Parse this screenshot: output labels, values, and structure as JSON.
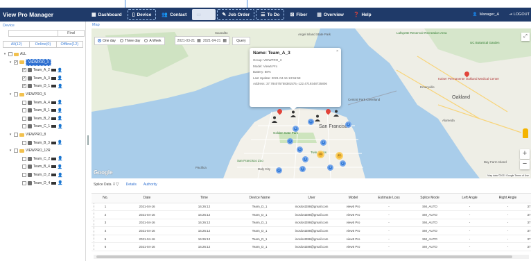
{
  "nav": {
    "brand": "View Pro Manager",
    "items": [
      {
        "label": "Dashboard",
        "icon": "grid-icon"
      },
      {
        "label": "Device",
        "icon": "phone-icon"
      },
      {
        "label": "Contact",
        "icon": "people-icon"
      },
      {
        "label": "",
        "icon": "monitor-icon"
      },
      {
        "label": "Job Order",
        "icon": "wrench-icon"
      },
      {
        "label": "To Do",
        "icon": "list-icon"
      },
      {
        "label": "Fiber",
        "icon": "fiber-icon"
      },
      {
        "label": "Overview",
        "icon": "chart-icon"
      },
      {
        "label": "Help",
        "icon": "help-icon"
      }
    ],
    "user": "Manager_A",
    "logout": "LOGOUT"
  },
  "side_fragments": [
    "ão",
    "s"
  ],
  "left_panel": {
    "title": "Device",
    "search_placeholder": "",
    "find_label": "Find",
    "filter_tabs": [
      "All(12)",
      "Online(0)",
      "Offline(12)"
    ],
    "tree": {
      "root": "ALL",
      "groups": [
        {
          "name": "VIEWPRO_3",
          "selected": true,
          "checked": true,
          "devices": [
            "Team_A_2",
            "Team_A_3",
            "Team_D_1"
          ]
        },
        {
          "name": "VIEWPRO_5",
          "selected": false,
          "checked": false,
          "devices": [
            "Team_A_4",
            "Team_B_1",
            "Team_B_2",
            "Team_C_1"
          ]
        },
        {
          "name": "VIEWPRO_8",
          "selected": false,
          "checked": false,
          "devices": [
            "Team_B_3"
          ]
        },
        {
          "name": "VIEWPRO_12R",
          "selected": false,
          "checked": false,
          "devices": [
            "Team_C_2",
            "Team_B_4",
            "Team_D_2",
            "Team_D_4"
          ]
        }
      ]
    }
  },
  "map": {
    "label": "Map",
    "ranges": [
      "One day",
      "Three day",
      "A Week"
    ],
    "selected_range": "One day",
    "date_from": "2021-03-21",
    "date_to": "2021-04-21",
    "query_label": "Query",
    "popup": {
      "title": "Name: Team_A_3",
      "lines": [
        "Group: VIEWPRO_3",
        "Model: View6 Pro",
        "Battery: 88%",
        "Last Update: 2021-04-16 13:56:58",
        "Address: 37.784075758381575,-122.4719348735806"
      ]
    },
    "places": [
      {
        "text": "Angel Island State Park",
        "cls": ""
      },
      {
        "text": "Lafayette Reservoir Recreation Area",
        "cls": "green"
      },
      {
        "text": "UC Botanical Garden",
        "cls": "green"
      },
      {
        "text": "Kaiser Permanente Oakland Medical Center",
        "cls": "red"
      },
      {
        "text": "Oakland",
        "cls": "big"
      },
      {
        "text": "Alameda",
        "cls": ""
      },
      {
        "text": "San Francisco",
        "cls": "big"
      },
      {
        "text": "Sausalito",
        "cls": ""
      },
      {
        "text": "Daly City",
        "cls": ""
      },
      {
        "text": "Bay Farm Island",
        "cls": ""
      },
      {
        "text": "San Francisco Zoo",
        "cls": "green"
      },
      {
        "text": "Golden Gate Park",
        "cls": "green"
      },
      {
        "text": "Twin Peaks",
        "cls": "green"
      },
      {
        "text": "Presidio of San Francisco",
        "cls": "green"
      },
      {
        "text": "Pacifica",
        "cls": ""
      },
      {
        "text": "Central Park Cleveland",
        "cls": ""
      },
      {
        "text": "Emeryville",
        "cls": ""
      }
    ],
    "clusters": [
      "2",
      "3",
      "5",
      "2",
      "2",
      "3",
      "2",
      "2",
      "3",
      "2",
      "10",
      "12",
      "2"
    ],
    "google_label": "Google",
    "attribution": "Map data ©2021 Google   Terms of Use",
    "zoom_in": "+",
    "zoom_out": "−"
  },
  "bottom": {
    "tab_title": "Splice Data",
    "tabs": [
      "Details",
      "Authority"
    ],
    "columns": [
      "No.",
      "Date",
      "Time",
      "Device Name",
      "User",
      "Model",
      "Estimate Loss",
      "Splice Mode",
      "Left Angle",
      "Right Angle",
      ""
    ],
    "rows": [
      [
        "1",
        "2021-04-16",
        "16:26:12",
        "Team_D_1",
        "inoslost288@gmail.com",
        "view5 Pro",
        "-",
        "SM_AUTO",
        "-",
        "-",
        "37"
      ],
      [
        "2",
        "2021-04-16",
        "16:26:12",
        "Team_D_1",
        "inoslost288@gmail.com",
        "view5 Pro",
        "-",
        "SM_AUTO",
        "-",
        "-",
        "37"
      ],
      [
        "3",
        "2021-04-16",
        "16:26:12",
        "Team_D_1",
        "inoslost288@gmail.com",
        "view5 Pro",
        "-",
        "SM_AUTO",
        "-",
        "-",
        "37"
      ],
      [
        "4",
        "2021-04-16",
        "16:26:12",
        "Team_D_1",
        "inoslost288@gmail.com",
        "view5 Pro",
        "-",
        "SM_AUTO",
        "-",
        "-",
        "37"
      ],
      [
        "5",
        "2021-04-16",
        "16:26:12",
        "Team_D_1",
        "inoslost288@gmail.com",
        "view5 Pro",
        "-",
        "SM_AUTO",
        "-",
        "-",
        "37"
      ],
      [
        "6",
        "2021-04-16",
        "16:26:12",
        "Team_D_1",
        "inoslost288@gmail.com",
        "view5 Pro",
        "-",
        "SM_AUTO",
        "-",
        "-",
        "37"
      ]
    ]
  }
}
